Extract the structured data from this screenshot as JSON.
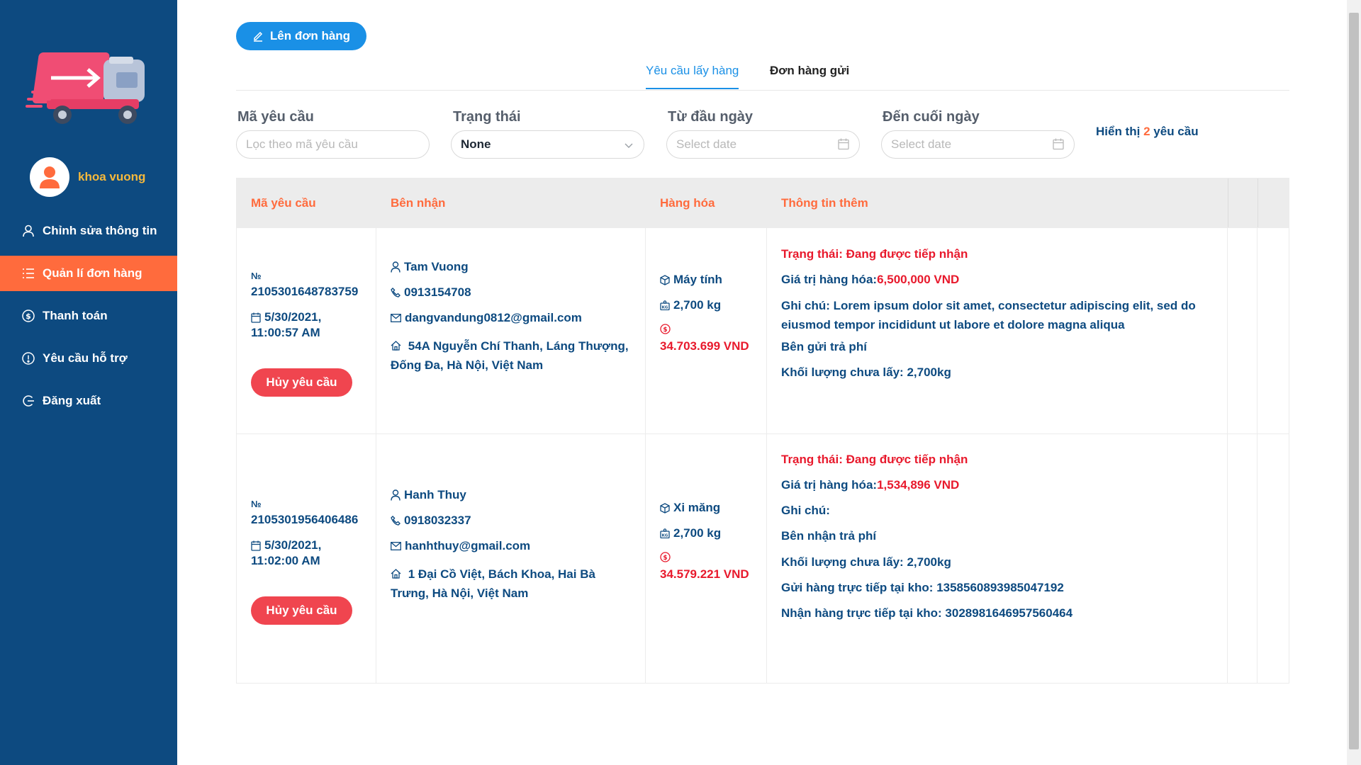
{
  "sidebar": {
    "user_name": "khoa vuong",
    "menu": [
      {
        "label": "Chỉnh sửa thông tin",
        "icon": "user-icon"
      },
      {
        "label": "Quản lí đơn hàng",
        "icon": "list-icon",
        "active": true
      },
      {
        "label": "Thanh toán",
        "icon": "dollar-icon"
      },
      {
        "label": "Yêu cầu hỗ trợ",
        "icon": "alert-icon"
      },
      {
        "label": "Đăng xuất",
        "icon": "logout-icon"
      }
    ]
  },
  "toolbar": {
    "create_label": "Lên đơn hàng"
  },
  "tabs": [
    {
      "label": "Yêu cầu lấy hàng",
      "active": true
    },
    {
      "label": "Đơn hàng gửi"
    }
  ],
  "filters": {
    "code": {
      "label": "Mã yêu cầu",
      "placeholder": "Lọc theo mã yêu cầu"
    },
    "status": {
      "label": "Trạng thái",
      "value": "None"
    },
    "from": {
      "label": "Từ đầu ngày",
      "placeholder": "Select date"
    },
    "to": {
      "label": "Đến cuối ngày",
      "placeholder": "Select date"
    }
  },
  "count": {
    "prefix": "Hiển thị",
    "number": "2",
    "suffix": "yêu cầu"
  },
  "table": {
    "headers": [
      "Mã yêu cầu",
      "Bên nhận",
      "Hàng hóa",
      "Thông tin thêm"
    ],
    "rows": [
      {
        "no_label": "№",
        "id": "2105301648783759",
        "date": "5/30/2021,",
        "time": "11:00:57 AM",
        "cancel_label": "Hủy yêu cầu",
        "receiver_name": "Tam Vuong",
        "phone": "0913154708",
        "email": "dangvandung0812@gmail.com",
        "address": "54A Nguyễn Chí Thanh, Láng Thượng, Đống Đa, Hà Nội, Việt Nam",
        "item": "Máy tính",
        "weight": "2,700 kg",
        "price": "34.703.699 VND",
        "status": "Trạng thái: Đang được tiếp nhận",
        "value_label": "Giá trị hàng hóa: ",
        "value": "6,500,000 VND",
        "note": "Ghi chú: Lorem ipsum dolor sit amet, consectetur adipiscing elit, sed do eiusmod tempor incididunt ut labore et dolore magna aliqua",
        "payer": "Bên gửi trả phí",
        "remaining": "Khối lượng chưa lấy: 2,700kg"
      },
      {
        "no_label": "№",
        "id": "2105301956406486",
        "date": "5/30/2021,",
        "time": "11:02:00 AM",
        "cancel_label": "Hủy yêu cầu",
        "receiver_name": "Hanh Thuy",
        "phone": "0918032337",
        "email": "hanhthuy@gmail.com",
        "address": "1 Đại Cồ Việt, Bách Khoa, Hai Bà Trưng, Hà Nội, Việt Nam",
        "item": "Xi măng",
        "weight": "2,700 kg",
        "price": "34.579.221 VND",
        "status": "Trạng thái: Đang được tiếp nhận",
        "value_label": "Giá trị hàng hóa: ",
        "value": "1,534,896 VND",
        "note": "Ghi chú:",
        "payer": "Bên nhận trả phí",
        "remaining": "Khối lượng chưa lấy: 2,700kg",
        "warehouse_send": "Gửi hàng trực tiếp tại kho: 1358560893985047192",
        "warehouse_receive": "Nhận hàng trực tiếp tại kho: 3028981646957560464"
      }
    ]
  },
  "colors": {
    "sidebar": "#0d4a80",
    "accent": "#ff6b3d",
    "primary": "#1a90e6",
    "danger": "#e8192c",
    "user_name": "#f6b93b"
  }
}
